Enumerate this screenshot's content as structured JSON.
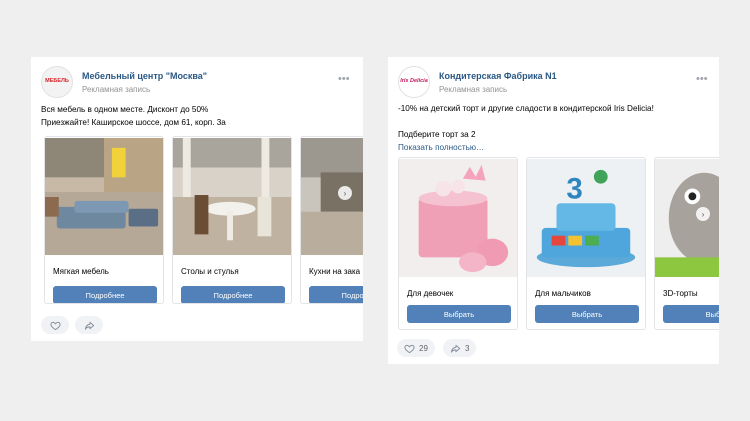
{
  "posts": [
    {
      "logo_text": "МЕБЕЛЬ",
      "author": "Мебельный центр \"Москва\"",
      "ad_label": "Рекламная запись",
      "more_icon": "more-icon",
      "text_lines": [
        "Вся мебель в одном месте. Дисконт до 50%",
        "Приезжайте! Каширское шоссе, дом 61, корп. 3а"
      ],
      "cards": [
        {
          "title": "Мягкая мебель",
          "button": "Подробнее"
        },
        {
          "title": "Столы и стулья",
          "button": "Подробнее"
        },
        {
          "title": "Кухни на зака",
          "button": "Подробнее"
        }
      ],
      "footer": {
        "like_count": "",
        "share_count": ""
      }
    },
    {
      "logo_text": "Iris Delicia",
      "author": "Кондитерская Фабрика N1",
      "ad_label": "Рекламная запись",
      "more_icon": "more-icon",
      "text_lines": [
        "-10% на детский торт и другие сладости в кондитерской Iris Delicia!",
        "",
        "Подберите торт за 2"
      ],
      "show_more": "Показать полностью…",
      "cards": [
        {
          "title": "Для девочек",
          "button": "Выбрать"
        },
        {
          "title": "Для мальчиков",
          "button": "Выбрать"
        },
        {
          "title": "3D-торты",
          "button": "Выбр"
        }
      ],
      "footer": {
        "like_count": "29",
        "share_count": "3"
      }
    }
  ],
  "colors": {
    "accent": "#5181b8",
    "link": "#2a5885",
    "muted": "#939393",
    "background": "#efefef"
  }
}
